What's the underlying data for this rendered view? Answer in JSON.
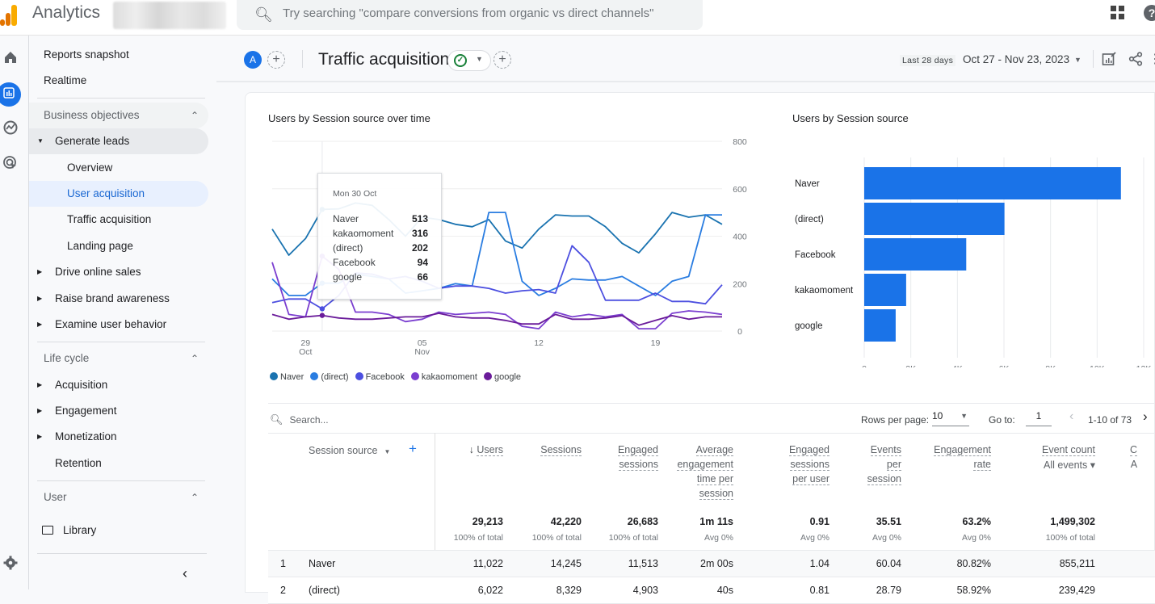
{
  "app": {
    "title": "Analytics",
    "search_placeholder": "Try searching \"compare conversions from organic vs direct channels\"",
    "logo_colors": [
      "#e37400",
      "#f9ab00",
      "#e37400"
    ]
  },
  "rail": {
    "icons": [
      "home-icon",
      "reports-icon",
      "explore-icon",
      "advertising-icon",
      "settings-icon"
    ],
    "active": "reports-icon"
  },
  "nav": {
    "reports_snapshot": "Reports snapshot",
    "realtime": "Realtime",
    "business_objectives": {
      "label": "Business objectives",
      "generate_leads": {
        "label": "Generate leads",
        "children": [
          "Overview",
          "User acquisition",
          "Traffic acquisition",
          "Landing page"
        ],
        "selected": "User acquisition"
      },
      "others": [
        "Drive online sales",
        "Raise brand awareness",
        "Examine user behavior"
      ]
    },
    "life_cycle": {
      "label": "Life cycle",
      "items": [
        "Acquisition",
        "Engagement",
        "Monetization",
        "Retention"
      ]
    },
    "user": {
      "label": "User"
    },
    "library": "Library"
  },
  "header": {
    "avatar_letter": "A",
    "title": "Traffic acquisition",
    "date_tag": "Last 28 days",
    "date_range": "Oct 27 - Nov 23, 2023"
  },
  "line_chart": {
    "title": "Users by Session source over time",
    "tooltip": {
      "date": "Mon 30 Oct",
      "rows": [
        {
          "name": "Naver",
          "value": "513"
        },
        {
          "name": "kakaomoment",
          "value": "316"
        },
        {
          "name": "(direct)",
          "value": "202"
        },
        {
          "name": "Facebook",
          "value": "94"
        },
        {
          "name": "google",
          "value": "66"
        }
      ]
    }
  },
  "bar_chart": {
    "title": "Users by Session source"
  },
  "chart_data": [
    {
      "type": "line",
      "title": "Users by Session source over time",
      "x": [
        "Oct 27",
        "Oct 28",
        "Oct 29",
        "Oct 30",
        "Oct 31",
        "Nov 1",
        "Nov 2",
        "Nov 3",
        "Nov 4",
        "Nov 5",
        "Nov 6",
        "Nov 7",
        "Nov 8",
        "Nov 9",
        "Nov 10",
        "Nov 11",
        "Nov 12",
        "Nov 13",
        "Nov 14",
        "Nov 15",
        "Nov 16",
        "Nov 17",
        "Nov 18",
        "Nov 19",
        "Nov 20",
        "Nov 21",
        "Nov 22",
        "Nov 23"
      ],
      "x_tick_labels": [
        {
          "x": "Oct 29",
          "label": "29",
          "sub": "Oct"
        },
        {
          "x": "Nov 5",
          "label": "05",
          "sub": "Nov"
        },
        {
          "x": "Nov 12",
          "label": "12",
          "sub": ""
        },
        {
          "x": "Nov 19",
          "label": "19",
          "sub": ""
        }
      ],
      "y_ticks": [
        0,
        200,
        400,
        600,
        800
      ],
      "ylim": [
        0,
        800
      ],
      "grid": true,
      "y_axis_side": "right",
      "legend_position": "bottom-left",
      "series": [
        {
          "name": "Naver",
          "color": "#1a73b0",
          "values": [
            430,
            320,
            390,
            513,
            515,
            540,
            530,
            470,
            400,
            480,
            470,
            450,
            440,
            470,
            380,
            350,
            430,
            490,
            485,
            485,
            440,
            370,
            330,
            410,
            500,
            480,
            490,
            450
          ]
        },
        {
          "name": "(direct)",
          "color": "#2a7de1",
          "values": [
            220,
            150,
            150,
            202,
            202,
            240,
            230,
            220,
            160,
            170,
            180,
            200,
            190,
            500,
            500,
            210,
            150,
            180,
            220,
            215,
            215,
            230,
            190,
            150,
            210,
            230,
            490,
            490
          ]
        },
        {
          "name": "Facebook",
          "color": "#4c4fe0",
          "values": [
            120,
            135,
            135,
            94,
            150,
            245,
            240,
            220,
            230,
            210,
            180,
            190,
            190,
            180,
            160,
            170,
            175,
            160,
            360,
            290,
            130,
            130,
            130,
            160,
            125,
            125,
            115,
            195
          ]
        },
        {
          "name": "kakaomoment",
          "color": "#7b3fd0",
          "values": [
            290,
            70,
            60,
            316,
            260,
            80,
            80,
            70,
            40,
            50,
            80,
            70,
            75,
            80,
            70,
            20,
            10,
            80,
            60,
            70,
            60,
            70,
            10,
            10,
            75,
            85,
            80,
            70
          ]
        },
        {
          "name": "google",
          "color": "#6a1b9a",
          "values": [
            70,
            50,
            60,
            66,
            55,
            50,
            50,
            55,
            60,
            60,
            75,
            60,
            55,
            55,
            45,
            30,
            30,
            70,
            50,
            50,
            55,
            65,
            25,
            45,
            65,
            50,
            60,
            60
          ]
        }
      ]
    },
    {
      "type": "bar",
      "orientation": "horizontal",
      "title": "Users by Session source",
      "categories": [
        "Naver",
        "(direct)",
        "Facebook",
        "kakaomoment",
        "google"
      ],
      "values": [
        11022,
        6022,
        4380,
        1800,
        1350
      ],
      "xlim": [
        0,
        12000
      ],
      "x_ticks": [
        0,
        2000,
        4000,
        6000,
        8000,
        10000,
        12000
      ],
      "x_tick_labels": [
        "0",
        "2K",
        "4K",
        "6K",
        "8K",
        "10K",
        "12K"
      ],
      "color": "#1a73e8",
      "grid": true
    }
  ],
  "table": {
    "search_placeholder": "Search...",
    "rows_per_page_label": "Rows per page:",
    "rows_per_page": "10",
    "goto_label": "Go to:",
    "goto_value": "1",
    "page_info": "1-10 of 73",
    "dimension": "Session source",
    "columns": [
      {
        "label": [
          "Users"
        ],
        "sorted": true,
        "total": "29,213",
        "sub": "100% of total"
      },
      {
        "label": [
          "Sessions"
        ],
        "total": "42,220",
        "sub": "100% of total"
      },
      {
        "label": [
          "Engaged",
          "sessions"
        ],
        "total": "26,683",
        "sub": "100% of total"
      },
      {
        "label": [
          "Average",
          "engagement",
          "time per",
          "session"
        ],
        "total": "1m 11s",
        "sub": "Avg 0%"
      },
      {
        "label": [
          "Engaged",
          "sessions",
          "per user"
        ],
        "total": "0.91",
        "sub": "Avg 0%"
      },
      {
        "label": [
          "Events",
          "per",
          "session"
        ],
        "total": "35.51",
        "sub": "Avg 0%"
      },
      {
        "label": [
          "Engagement",
          "rate"
        ],
        "total": "63.2%",
        "sub": "Avg 0%"
      },
      {
        "label": [
          "Event count"
        ],
        "selector": "All events",
        "total": "1,499,302",
        "sub": "100% of total"
      }
    ],
    "rows": [
      {
        "rank": "1",
        "source": "Naver",
        "values": [
          "11,022",
          "14,245",
          "11,513",
          "2m 00s",
          "1.04",
          "60.04",
          "80.82%",
          "855,211"
        ]
      },
      {
        "rank": "2",
        "source": "(direct)",
        "values": [
          "6,022",
          "8,329",
          "4,903",
          "40s",
          "0.81",
          "28.79",
          "58.92%",
          "239,429"
        ]
      }
    ]
  }
}
